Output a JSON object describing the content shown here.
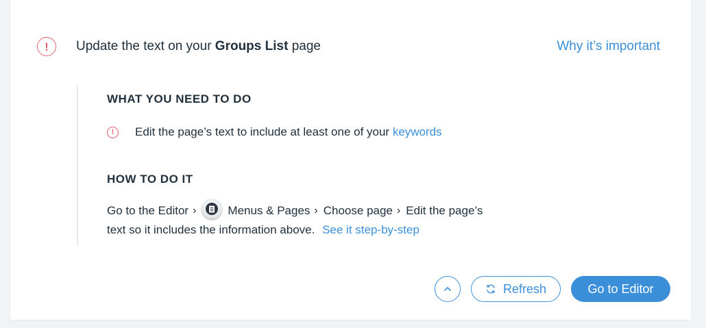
{
  "task": {
    "title_prefix": "Update the text on your ",
    "title_bold": "Groups List",
    "title_suffix": " page",
    "why_link": "Why it’s important"
  },
  "what_to_do": {
    "heading": "WHAT YOU NEED TO DO",
    "requirement_text": "Edit the page’s text to include at least one of your ",
    "requirement_link": "keywords"
  },
  "how_to_do": {
    "heading": "HOW TO DO IT",
    "step1": "Go to the Editor",
    "step2": "Menus & Pages",
    "step3": "Choose page",
    "step4_line1": " Edit the page’s",
    "step4_line2": "text so it includes the information above.",
    "guide_link": "See it step-by-step"
  },
  "footer": {
    "refresh_label": "Refresh",
    "go_to_editor_label": "Go to Editor"
  },
  "colors": {
    "accent": "#3b8fd8",
    "alert": "#e66070",
    "text": "#20303c"
  },
  "icons": {
    "alert": "alert-circle-icon",
    "menu": "menus-pages-icon",
    "collapse": "chevron-up-icon",
    "refresh": "refresh-icon"
  }
}
